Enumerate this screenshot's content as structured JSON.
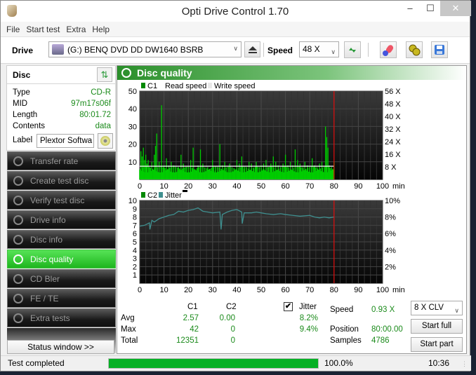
{
  "window": {
    "title": "Opti Drive Control 1.70",
    "minimize": "–",
    "maximize": "☐",
    "close": "✕"
  },
  "menu": [
    "File",
    "Start test",
    "Extra",
    "Help"
  ],
  "toolbar": {
    "drive_label": "Drive",
    "drive_value": "(G:)   BENQ DVD DD DW1640 BSRB",
    "speed_label": "Speed",
    "speed_value": "48 X",
    "icons": [
      "eject-icon",
      "refresh-icon",
      "erase-icon",
      "settings-icon",
      "save-icon"
    ]
  },
  "disc": {
    "header": "Disc",
    "type_label": "Type",
    "type_value": "CD-R",
    "mid_label": "MID",
    "mid_value": "97m17s06f",
    "length_label": "Length",
    "length_value": "80:01.72",
    "contents_label": "Contents",
    "contents_value": "data",
    "label_label": "Label",
    "label_value": "Plextor Softwa"
  },
  "nav": [
    {
      "label": "Transfer rate",
      "active": false
    },
    {
      "label": "Create test disc",
      "active": false
    },
    {
      "label": "Verify test disc",
      "active": false
    },
    {
      "label": "Drive info",
      "active": false
    },
    {
      "label": "Disc info",
      "active": false
    },
    {
      "label": "Disc quality",
      "active": true
    },
    {
      "label": "CD Bler",
      "active": false
    },
    {
      "label": "FE / TE",
      "active": false
    },
    {
      "label": "Extra tests",
      "active": false
    }
  ],
  "status_window_button": "Status window >>",
  "panel": {
    "title": "Disc quality"
  },
  "colors": {
    "c1": "#00cc00",
    "jitter": "#3f8f8f",
    "marker": "#ff0000",
    "read_speed": "#ffffff",
    "accent": "#1fb61f"
  },
  "chart_data": [
    {
      "type": "bar",
      "title": "C1",
      "legend": [
        "C1",
        "Read speed",
        "Write speed"
      ],
      "xlabel": "min",
      "x_ticks": [
        "0",
        "10",
        "20",
        "30",
        "40",
        "50",
        "60",
        "70",
        "80",
        "90",
        "100"
      ],
      "xlim": [
        0,
        100
      ],
      "ylim_left": [
        0,
        50
      ],
      "y_ticks_left": [
        "10",
        "20",
        "30",
        "40",
        "50"
      ],
      "y_ticks_right": [
        "8 X",
        "16 X",
        "24 X",
        "32 X",
        "40 X",
        "48 X",
        "56 X"
      ],
      "ylim_right": [
        0,
        56
      ],
      "marker_x": 80,
      "read_speed_x": 7.5,
      "c1_spikes": [
        [
          0.5,
          16
        ],
        [
          1,
          13
        ],
        [
          1.5,
          18
        ],
        [
          2,
          11
        ],
        [
          2.5,
          14
        ],
        [
          3,
          9
        ],
        [
          3.5,
          11
        ],
        [
          4,
          7
        ],
        [
          5,
          10
        ],
        [
          6,
          14
        ],
        [
          6.5,
          19
        ],
        [
          7,
          26
        ],
        [
          8,
          10
        ],
        [
          9,
          42
        ],
        [
          10,
          8
        ],
        [
          11,
          12
        ],
        [
          12,
          8
        ],
        [
          13,
          10
        ],
        [
          14,
          8
        ],
        [
          16,
          7
        ],
        [
          17,
          14
        ],
        [
          18,
          9
        ],
        [
          19,
          7
        ],
        [
          20,
          6
        ],
        [
          21,
          11
        ],
        [
          22,
          18
        ],
        [
          24,
          8
        ],
        [
          25,
          17
        ],
        [
          26,
          9
        ],
        [
          28,
          7
        ],
        [
          29,
          6
        ],
        [
          30,
          11
        ],
        [
          31,
          5
        ],
        [
          33,
          20
        ],
        [
          34,
          8
        ],
        [
          35,
          10
        ],
        [
          37,
          9
        ],
        [
          39,
          6
        ],
        [
          40,
          11
        ],
        [
          41,
          9
        ],
        [
          42,
          13
        ],
        [
          43,
          6
        ],
        [
          44,
          7
        ],
        [
          45,
          10
        ],
        [
          46,
          9
        ],
        [
          47,
          6
        ],
        [
          48,
          10
        ],
        [
          50,
          8
        ],
        [
          51,
          9
        ],
        [
          52,
          11
        ],
        [
          53,
          7
        ],
        [
          54,
          9
        ],
        [
          55,
          13
        ],
        [
          56,
          10
        ],
        [
          57,
          8
        ],
        [
          58,
          7
        ],
        [
          59,
          9
        ],
        [
          60,
          14
        ],
        [
          61,
          8
        ],
        [
          62,
          10
        ],
        [
          63,
          8
        ],
        [
          64,
          17
        ],
        [
          65,
          11
        ],
        [
          66,
          9
        ],
        [
          67,
          7
        ],
        [
          68,
          10
        ],
        [
          69,
          8
        ],
        [
          70,
          6
        ],
        [
          71,
          12
        ],
        [
          72,
          8
        ],
        [
          73,
          7
        ],
        [
          74,
          9
        ],
        [
          75,
          10
        ],
        [
          76,
          6
        ],
        [
          76.5,
          30
        ],
        [
          77,
          24
        ],
        [
          77.5,
          18
        ],
        [
          78,
          8
        ],
        [
          79,
          7
        ],
        [
          80,
          10
        ]
      ],
      "c1_baseline": 4,
      "stats": {
        "avg": 2.57,
        "max": 42,
        "total": 12351
      }
    },
    {
      "type": "line",
      "title": "C2 / Jitter",
      "legend": [
        "C2",
        "Jitter"
      ],
      "xlabel": "min",
      "x_ticks": [
        "0",
        "10",
        "20",
        "30",
        "40",
        "50",
        "60",
        "70",
        "80",
        "90",
        "100"
      ],
      "xlim": [
        0,
        100
      ],
      "ylim_left": [
        0,
        10
      ],
      "y_ticks_left": [
        "1",
        "2",
        "3",
        "4",
        "5",
        "6",
        "7",
        "8",
        "9",
        "10"
      ],
      "y_ticks_right": [
        "2%",
        "4%",
        "6%",
        "8%",
        "10%"
      ],
      "ylim_right": [
        0,
        10
      ],
      "marker_x": 80,
      "jitter": [
        [
          0,
          6.9
        ],
        [
          2,
          7.0
        ],
        [
          4,
          7.3
        ],
        [
          4.2,
          6.5
        ],
        [
          5,
          7.6
        ],
        [
          6,
          7.4
        ],
        [
          8,
          7.8
        ],
        [
          10,
          8.0
        ],
        [
          12,
          8.2
        ],
        [
          14,
          8.3
        ],
        [
          16,
          8.7
        ],
        [
          18,
          8.6
        ],
        [
          20,
          8.8
        ],
        [
          22,
          8.9
        ],
        [
          24,
          9.1
        ],
        [
          26,
          8.7
        ],
        [
          28,
          8.6
        ],
        [
          30,
          8.5
        ],
        [
          33,
          8.6
        ],
        [
          33.5,
          6.5
        ],
        [
          34,
          8.3
        ],
        [
          36,
          8.6
        ],
        [
          38,
          8.8
        ],
        [
          40,
          8.9
        ],
        [
          42,
          8.6
        ],
        [
          42.2,
          7.2
        ],
        [
          43,
          8.5
        ],
        [
          46,
          8.5
        ],
        [
          48,
          8.6
        ],
        [
          50,
          8.5
        ],
        [
          52,
          8.4
        ],
        [
          55,
          8.3
        ],
        [
          58,
          8.4
        ],
        [
          60,
          8.3
        ],
        [
          63,
          8.2
        ],
        [
          66,
          8.1
        ],
        [
          70,
          8.2
        ],
        [
          72,
          8.0
        ],
        [
          74,
          7.9
        ],
        [
          76,
          8.0
        ],
        [
          78,
          7.9
        ],
        [
          80,
          8.0
        ]
      ],
      "c2_values": [],
      "stats": {
        "c2_avg": "0.00",
        "c2_max": 0,
        "c2_total": 0,
        "jitter_avg": "8.2%",
        "jitter_max": "9.4%"
      }
    }
  ],
  "stats": {
    "col_c1": "C1",
    "col_c2": "C2",
    "jitter_label": "Jitter",
    "jitter_checked": true,
    "avg_label": "Avg",
    "max_label": "Max",
    "total_label": "Total",
    "c1_avg": "2.57",
    "c2_avg": "0.00",
    "jitter_avg": "8.2%",
    "c1_max": "42",
    "c2_max": "0",
    "jitter_max": "9.4%",
    "c1_total": "12351",
    "c2_total": "0",
    "speed_label": "Speed",
    "speed_value": "0.93 X",
    "position_label": "Position",
    "position_value": "80:00.00",
    "samples_label": "Samples",
    "samples_value": "4786",
    "mode_value": "8 X CLV",
    "start_full": "Start full",
    "start_part": "Start part"
  },
  "statusbar": {
    "text": "Test completed",
    "progress": 100.0,
    "progress_text": "100.0%",
    "time": "10:36"
  }
}
